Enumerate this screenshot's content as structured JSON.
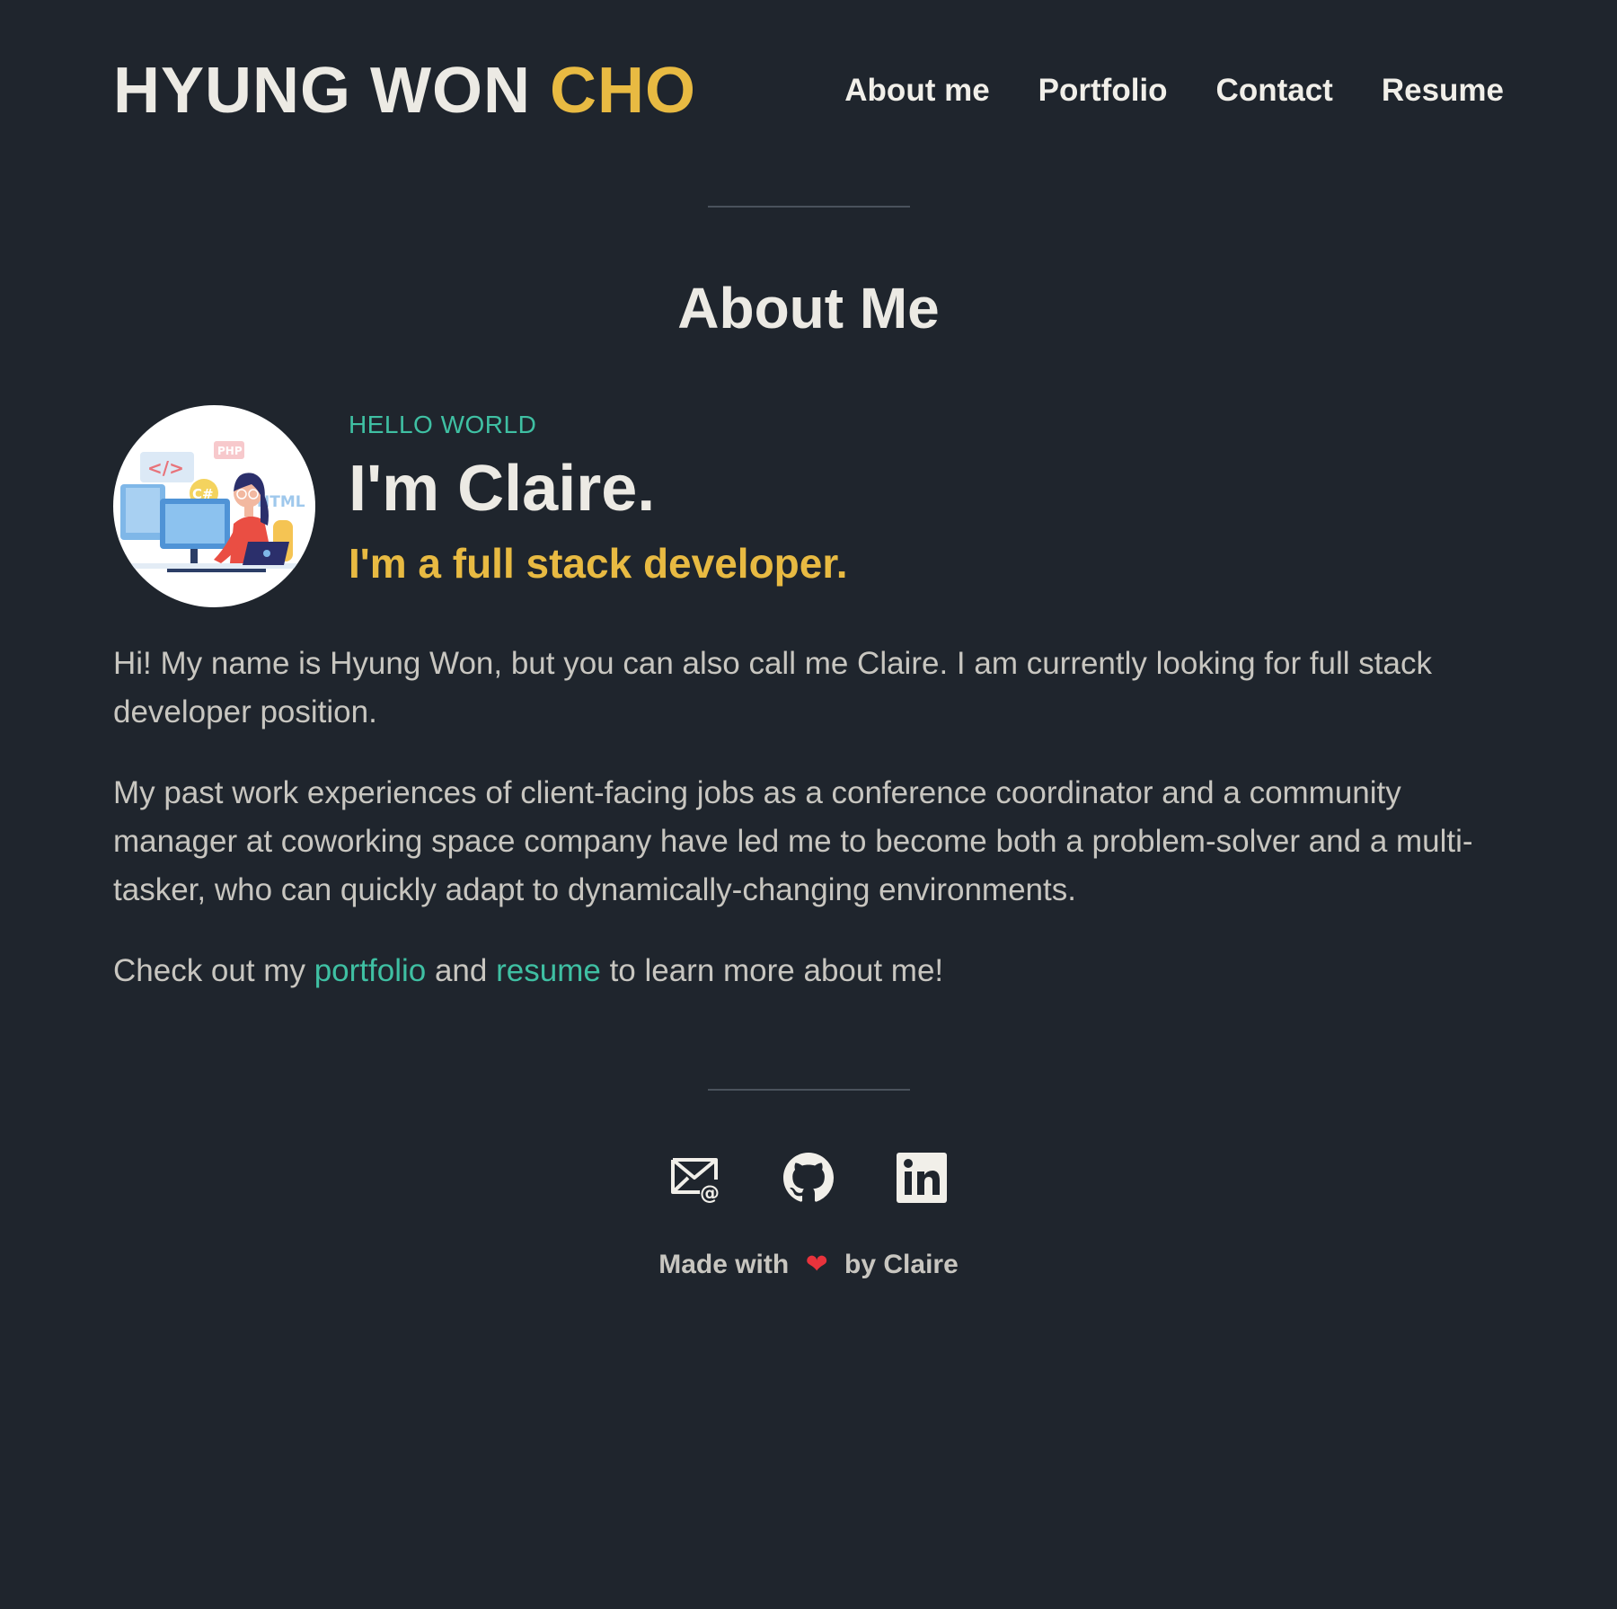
{
  "header": {
    "logo_first": "HYUNG WON",
    "logo_last": "CHO",
    "nav": [
      {
        "label": "About me"
      },
      {
        "label": "Portfolio"
      },
      {
        "label": "Contact"
      },
      {
        "label": "Resume"
      }
    ]
  },
  "about": {
    "title": "About Me",
    "eyebrow": "HELLO WORLD",
    "greeting": "I'm Claire.",
    "role": "I'm a full stack developer.",
    "paragraph_1": "Hi! My name is Hyung Won, but you can also call me Claire. I am currently looking for full stack developer position.",
    "paragraph_2": "My past work experiences of client-facing jobs as a conference coordinator and a community manager at coworking space company have led me to become both a problem-solver and a multi-tasker, who can quickly adapt to dynamically-changing environments.",
    "cta_prefix": "Check out my",
    "cta_link_1": "portfolio",
    "cta_middle": "and",
    "cta_link_2": "resume",
    "cta_suffix": "to learn more about me!"
  },
  "avatar_labels": {
    "code": "</>",
    "php": "PHP",
    "csharp": "C#",
    "html": "HTML"
  },
  "socials": [
    {
      "icon": "email-icon"
    },
    {
      "icon": "github-icon"
    },
    {
      "icon": "linkedin-icon"
    }
  ],
  "footer": {
    "prefix": "Made with",
    "heart": "❤",
    "suffix": "by Claire"
  },
  "colors": {
    "background": "#1f252d",
    "accent_yellow": "#e8ba42",
    "accent_teal": "#3fc0a3",
    "heading": "#eceae4",
    "body_text": "#c8c6c0",
    "heart": "#e8333c"
  }
}
